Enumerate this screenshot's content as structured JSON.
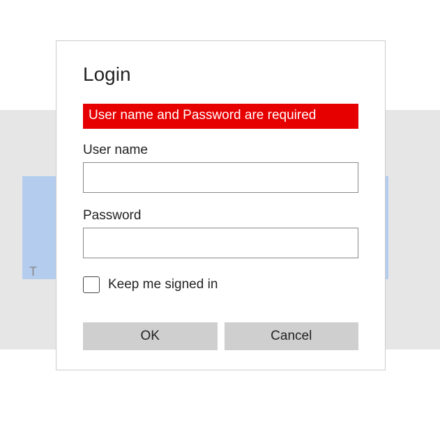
{
  "background": {
    "partial_text": "T"
  },
  "dialog": {
    "title": "Login",
    "error_message": "User name and Password are required",
    "username_label": "User name",
    "username_value": "",
    "password_label": "Password",
    "password_value": "",
    "remember_label": "Keep me signed in",
    "remember_checked": false,
    "ok_label": "OK",
    "cancel_label": "Cancel"
  }
}
